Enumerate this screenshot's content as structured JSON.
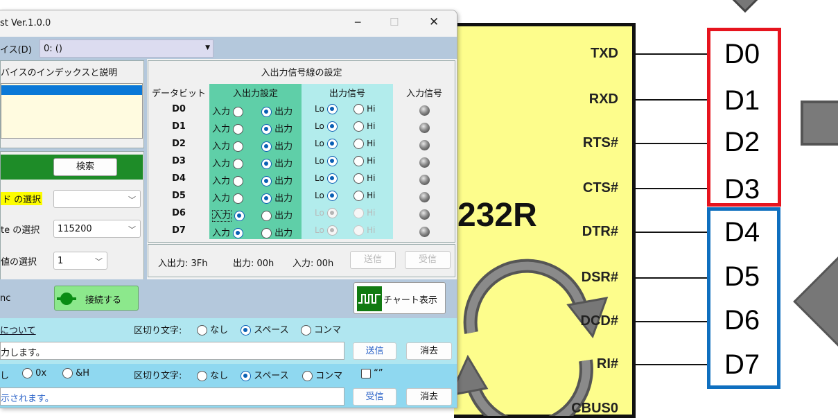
{
  "window": {
    "title": "st Ver.1.0.0",
    "device_label": "イス(D)",
    "device_value": "0: ()",
    "device_group_title": "バイスのインデックスと説明",
    "search_button": "検索",
    "mode_label": "ド の選択",
    "baud_label": "te の選択",
    "baud_value": "115200",
    "value_label": "値の選択",
    "value_value": "1",
    "sync_label": "nc",
    "connect_button": "接続する",
    "chart_button": "チャート表示"
  },
  "io_panel": {
    "title": "入出力信号線の設定",
    "headers": {
      "data_bit": "データビット",
      "io_setting": "入出力設定",
      "output_signal": "出力信号",
      "input_signal": "入力信号"
    },
    "in_label": "入力",
    "out_label": "出力",
    "lo_label": "Lo",
    "hi_label": "Hi",
    "rows": [
      {
        "bit": "D0",
        "io": "out",
        "level": "lo",
        "enabled": true
      },
      {
        "bit": "D1",
        "io": "out",
        "level": "lo",
        "enabled": true
      },
      {
        "bit": "D2",
        "io": "out",
        "level": "lo",
        "enabled": true
      },
      {
        "bit": "D3",
        "io": "out",
        "level": "lo",
        "enabled": true
      },
      {
        "bit": "D4",
        "io": "out",
        "level": "lo",
        "enabled": true
      },
      {
        "bit": "D5",
        "io": "out",
        "level": "lo",
        "enabled": true
      },
      {
        "bit": "D6",
        "io": "in",
        "level": "lo",
        "enabled": false
      },
      {
        "bit": "D7",
        "io": "in",
        "level": "lo",
        "enabled": false
      }
    ],
    "status_io": "入出力: 3Fh",
    "status_out": "出力: 00h",
    "status_in": "入力: 00h",
    "send_button": "送信",
    "recv_button": "受信"
  },
  "send_section": {
    "link": "について",
    "delimiter_label": "区切り文字:",
    "opt_none": "なし",
    "opt_space": "スペース",
    "opt_comma": "コンマ",
    "input_text": "力します。",
    "send_button": "送信",
    "clear_button": "消去"
  },
  "recv_section": {
    "fmt_none": "し",
    "fmt_0x": "0x",
    "fmt_amp": "&H",
    "delimiter_label": "区切り文字:",
    "opt_none": "なし",
    "opt_space": "スペース",
    "opt_comma": "コンマ",
    "quote_label": "“”",
    "output_text": "示されます。",
    "recv_button": "受信",
    "clear_button": "消去"
  },
  "diagram": {
    "chip_text": "232R",
    "pins": [
      "TXD",
      "RXD",
      "RTS#",
      "CTS#",
      "DTR#",
      "DSR#",
      "DCD#",
      "RI#",
      "CBUS0"
    ],
    "labels": [
      "D0",
      "D1",
      "D2",
      "D3",
      "D4",
      "D5",
      "D6",
      "D7"
    ],
    "colors": {
      "chip": "#fdfd8c",
      "red_box": "#e6141e",
      "blue_box": "#0f6fbf",
      "teal_io": "#5fcfa8",
      "cyan_io": "#b2ecec"
    }
  }
}
